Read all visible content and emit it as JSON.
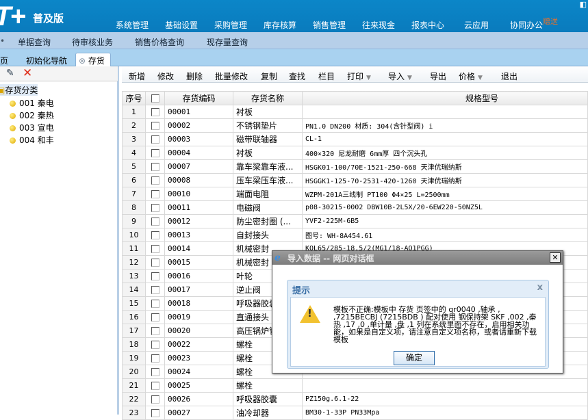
{
  "header": {
    "logo": "T+",
    "edition": "普及版",
    "menus": [
      "系统管理",
      "基础设置",
      "采购管理",
      "库存核算",
      "销售管理",
      "往来现金",
      "报表中心",
      "云应用",
      "协同办公"
    ],
    "gift_badge": "赠送"
  },
  "subnav": [
    "单据查询",
    "待审核业务",
    "销售价格查询",
    "现存量查询"
  ],
  "tabs": {
    "items": [
      "首页",
      "初始化导航"
    ],
    "active": "存货"
  },
  "tree": {
    "root": "存货分类",
    "items": [
      "001 秦电",
      "002 秦热",
      "003 宣电",
      "004 和丰"
    ]
  },
  "toolbar": {
    "buttons": [
      "新增",
      "修改",
      "删除",
      "批量修改",
      "复制",
      "查找",
      "栏目"
    ],
    "dropdowns": [
      "打印",
      "导入"
    ],
    "export": "导出",
    "price": "价格",
    "exit": "退出"
  },
  "grid": {
    "columns": [
      "序号",
      "",
      "存货编码",
      "存货名称",
      "规格型号"
    ],
    "rows": [
      [
        "1",
        "00001",
        "衬板",
        ""
      ],
      [
        "2",
        "00002",
        "不锈钢垫片",
        "PN1.0 DN200 材质: 304(含针型阀) i"
      ],
      [
        "3",
        "00003",
        "磁带联轴器",
        "CL-1"
      ],
      [
        "4",
        "00004",
        "衬板",
        "400×320 尼龙耐磨 6mm厚 四个沉头孔"
      ],
      [
        "5",
        "00007",
        "靠车梁靠车液...",
        "HSGK01-100/70E-1521-250-668 天津优瑞纳斯"
      ],
      [
        "6",
        "00008",
        "压车梁压车液...",
        "HSGGK1-125-70-2531-420-1260 天津优瑞纳斯"
      ],
      [
        "7",
        "00010",
        "端面电阻",
        "WZPM-201A三线制 PT100 Φ4×25 L=2500mm"
      ],
      [
        "8",
        "00011",
        "电磁阀",
        "p08-30215-0002 DBW10B-2L5X/20-6EW220-50NZ5L"
      ],
      [
        "9",
        "00012",
        "防尘密封圈 (...",
        "YVF2-225M-6B5"
      ],
      [
        "10",
        "00013",
        "自封接头",
        "图号: WH-8A454.61"
      ],
      [
        "11",
        "00014",
        "机械密封",
        "KQL65/285-18.5/2(MG1/18-AQ1PGG)"
      ],
      [
        "12",
        "00015",
        "机械密封",
        ""
      ],
      [
        "13",
        "00016",
        "叶轮",
        ""
      ],
      [
        "14",
        "00017",
        "逆止阀",
        ""
      ],
      [
        "15",
        "00018",
        "呼吸器胶囊",
        ""
      ],
      [
        "16",
        "00019",
        "直通接头",
        ""
      ],
      [
        "17",
        "00020",
        "高压锅炉管",
        ""
      ],
      [
        "18",
        "00022",
        "螺栓",
        ""
      ],
      [
        "19",
        "00023",
        "螺栓",
        ""
      ],
      [
        "20",
        "00024",
        "螺栓",
        ""
      ],
      [
        "21",
        "00025",
        "螺栓",
        ""
      ],
      [
        "22",
        "00026",
        "呼吸器胶囊",
        "PZ150g.6.1-22"
      ],
      [
        "23",
        "00027",
        "油冷却器",
        "BM30-1-33P PN33Mpa"
      ]
    ]
  },
  "dialog": {
    "title": "导入数据 -- 网页对话框",
    "close": "✕",
    "inner_title": "提示",
    "inner_close": "x",
    "message": "模板不正确:模板中 存货 页签中的 qr0040 ,轴承 , ,7215BECBJ (7215BDB ) 配对使用 钢保持架 SKF ,002 ,秦热 ,17 ,0 ,单计量 ,盘 ,1 列在系统里面不存在，启用相关功能，如果是自定义项，请注意自定义项名称，或者请重新下载模板",
    "ok": "确定"
  }
}
